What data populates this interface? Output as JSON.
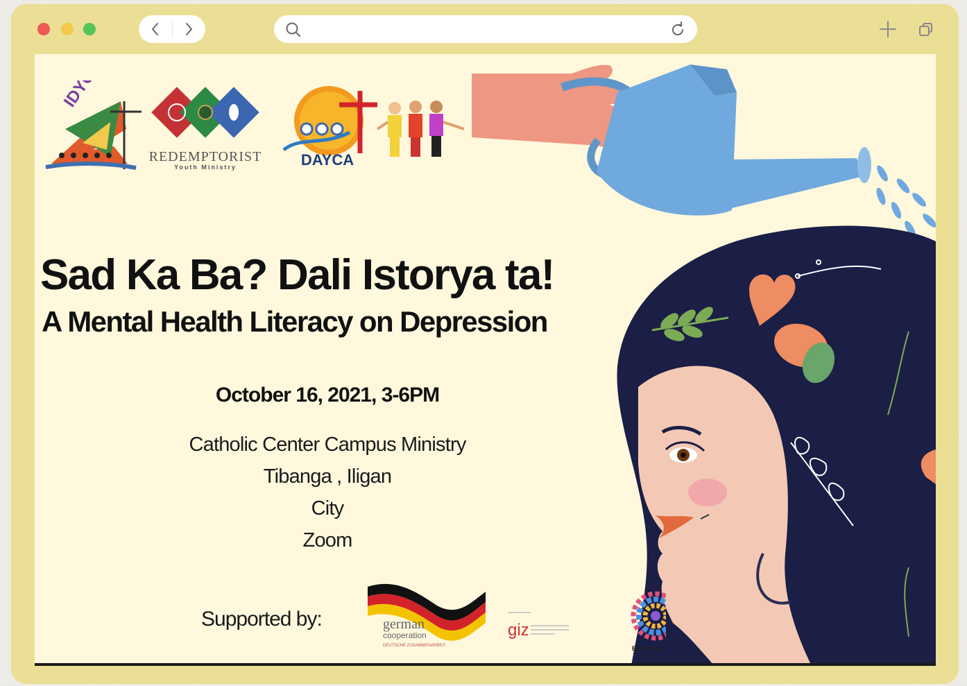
{
  "browser": {
    "url_placeholder": "",
    "colors": {
      "frame": "#ebde95",
      "close": "#ee5a52",
      "minimize": "#f2c94c",
      "maximize": "#52c459"
    },
    "icons": [
      "back-icon",
      "forward-icon",
      "search-icon",
      "reload-icon",
      "plus-icon",
      "tabs-icon"
    ]
  },
  "poster": {
    "logos": {
      "idyc": "IDYC",
      "redemptorist": "REDEMPTORIST",
      "redemptorist_sub": "Youth Ministry",
      "dayca": "DAYCA"
    },
    "title": "Sad Ka Ba? Dali Istorya ta!",
    "subtitle": "A Mental Health Literacy on Depression",
    "date": "October 16, 2021, 3-6PM",
    "venue": [
      "Catholic Center Campus Ministry",
      "Tibanga , Iligan",
      "City",
      "Zoom"
    ],
    "supported_label": "Supported by:",
    "sponsors": {
      "german_1": "german",
      "german_2": "cooperation",
      "german_3": "DEUTSCHE ZUSAMMENARBEIT",
      "giz": "giz",
      "balik": "BALIK KALIPAY"
    },
    "colors": {
      "background": "#fff8dd",
      "hair": "#1b1e45",
      "skin": "#f3c9b5",
      "can": "#6fa9dd",
      "accent": "#ee8c62"
    }
  }
}
